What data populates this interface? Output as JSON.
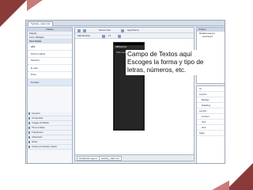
{
  "editor_tabs": {
    "active": "*activity_main.xml"
  },
  "palette": {
    "title": "Palette",
    "rows": [
      "Palette",
      "Form Widgets",
      "Text Fields"
    ],
    "samples": [
      "abc",
      "Person Name",
      "Password",
      "Password (Numeric)",
      "E-mail",
      "Phone",
      "Postal Address",
      "Multiline Text",
      "Time",
      "Date",
      "Number"
    ],
    "categories": [
      "Layouts",
      "Composite",
      "Images & Media",
      "Time & Date",
      "Transitions",
      "Advanced",
      "Other",
      "Custom & Library Views"
    ]
  },
  "toolbar": {
    "device": "Nexus One",
    "theme": "AppTheme",
    "activity": "MainActivity",
    "api": "17"
  },
  "device": {
    "title": "MiDiseño1",
    "body_text": "Hola mundo!"
  },
  "bottom_tabs": [
    "Graphical Layout",
    "activity_main.xml"
  ],
  "outline": {
    "title": "Outline",
    "items": [
      "RelativeLayout",
      "textView1",
      "editText1"
    ]
  },
  "properties": {
    "rows": [
      "Id",
      "Layout...",
      "Backgr...",
      "Padding",
      "Layout...",
      "Conten...",
      "Text",
      "Hint",
      "Style"
    ]
  },
  "caption": {
    "lines": [
      "Campo de Textos aquí",
      "Escoges la forma y tipo de",
      "letras, números, etc."
    ]
  }
}
